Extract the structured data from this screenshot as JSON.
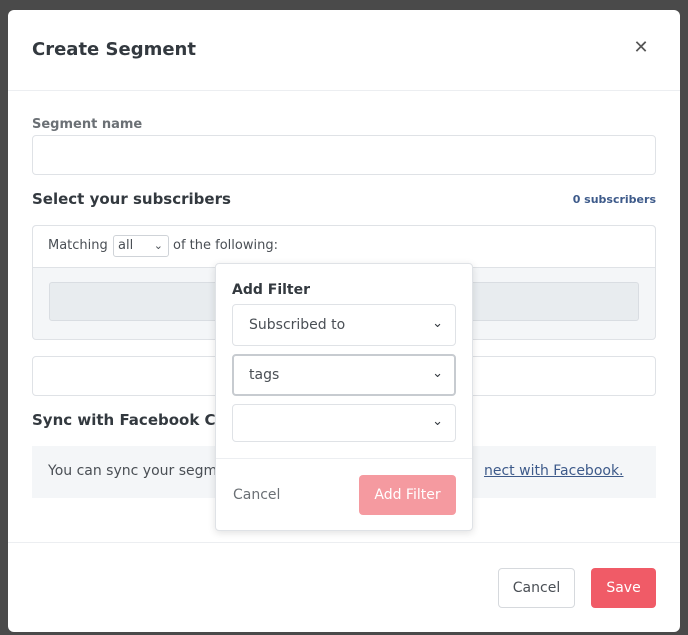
{
  "modal": {
    "title": "Create Segment",
    "close_icon": "close-icon"
  },
  "segment_name": {
    "label": "Segment name",
    "value": "",
    "placeholder": ""
  },
  "subscribers": {
    "title": "Select your subscribers",
    "count": "0 subscribers",
    "matching_prefix": "Matching",
    "matching_value": "all",
    "matching_suffix": "of the following:"
  },
  "facebook": {
    "title": "Sync with Facebook Cus",
    "text": "You can sync your segmen",
    "link": "nect with Facebook."
  },
  "footer": {
    "cancel": "Cancel",
    "save": "Save"
  },
  "popover": {
    "title": "Add Filter",
    "field1": "Subscribed to",
    "field2": "tags",
    "field3": "",
    "cancel": "Cancel",
    "add": "Add Filter"
  },
  "colors": {
    "accent": "#f05b67",
    "accent_disabled": "#f59aa0",
    "link": "#3d5a8a"
  }
}
